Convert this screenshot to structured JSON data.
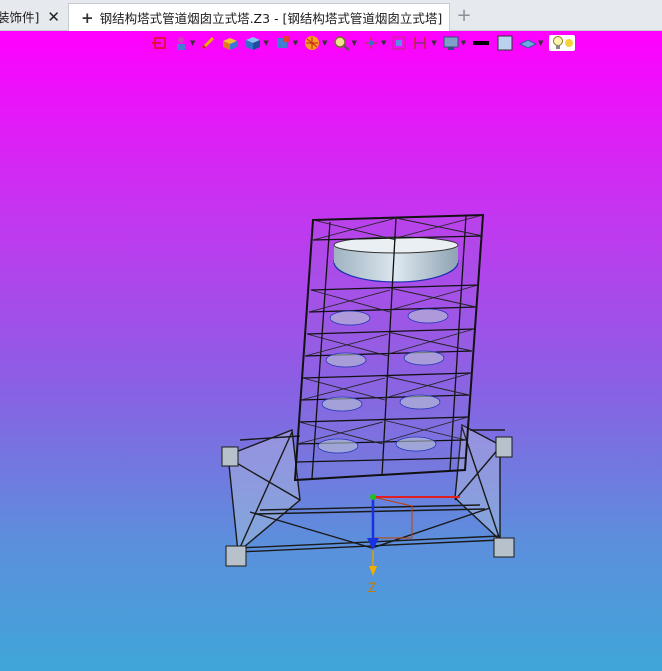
{
  "tabs": [
    {
      "label": "装饰件]",
      "active": false
    },
    {
      "label": "钢结构塔式管道烟囱立式塔.Z3 - [钢结构塔式管道烟囱立式塔]",
      "active": true
    }
  ],
  "tab_add_symbol": "+",
  "tab_close_symbol": "✕",
  "new_tab_symbol": "+",
  "toolbar": {
    "icons": [
      "exit-sketch-icon",
      "component-icon",
      "pencil-icon",
      "shaded-box-icon",
      "iso-cube-icon",
      "view-cube-icon",
      "render-mode-icon",
      "zoom-icon",
      "axis-pan-icon",
      "frame-select-icon",
      "section-icon",
      "display-icon",
      "line-color-icon",
      "fill-color-icon",
      "layer-icon",
      "light-bulb-icon"
    ]
  },
  "viewport": {
    "background_top": "#ff00ff",
    "background_bottom": "#3fa6d8",
    "axis_label": "Z"
  }
}
